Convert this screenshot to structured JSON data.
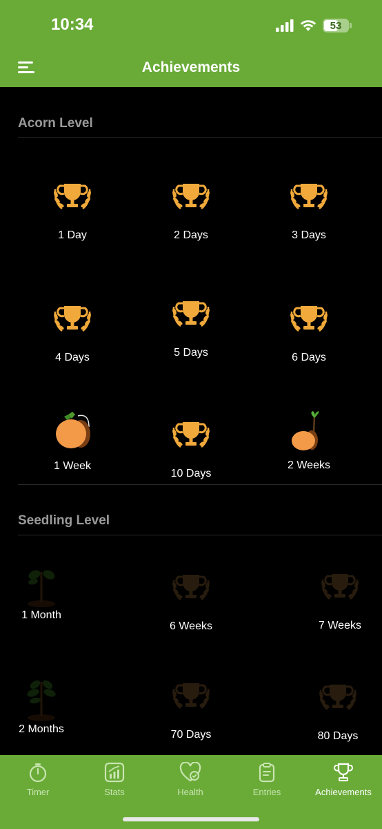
{
  "status_bar": {
    "time": "10:34",
    "battery": "53"
  },
  "header": {
    "title": "Achievements"
  },
  "sections": [
    {
      "title": "Acorn Level",
      "items": [
        {
          "label": "1 Day",
          "icon": "trophy-icon"
        },
        {
          "label": "2 Days",
          "icon": "trophy-icon"
        },
        {
          "label": "3 Days",
          "icon": "trophy-icon"
        },
        {
          "label": "4 Days",
          "icon": "trophy-icon"
        },
        {
          "label": "5 Days",
          "icon": "trophy-icon"
        },
        {
          "label": "6 Days",
          "icon": "trophy-icon"
        },
        {
          "label": "1 Week",
          "icon": "acorn-icon"
        },
        {
          "label": "10 Days",
          "icon": "trophy-icon"
        },
        {
          "label": "2 Weeks",
          "icon": "sprouting-acorn-icon"
        }
      ]
    },
    {
      "title": "Seedling Level",
      "items": [
        {
          "label": "1 Month",
          "icon": "seedling-icon"
        },
        {
          "label": "6 Weeks",
          "icon": "trophy-icon"
        },
        {
          "label": "7 Weeks",
          "icon": "trophy-icon"
        },
        {
          "label": "2 Months",
          "icon": "seedling-icon"
        },
        {
          "label": "70 Days",
          "icon": "trophy-icon"
        },
        {
          "label": "80 Days",
          "icon": "trophy-icon"
        }
      ]
    }
  ],
  "tabs": [
    {
      "label": "Timer",
      "icon": "stopwatch-icon"
    },
    {
      "label": "Stats",
      "icon": "chart-icon"
    },
    {
      "label": "Health",
      "icon": "heart-check-icon"
    },
    {
      "label": "Entries",
      "icon": "clipboard-icon"
    },
    {
      "label": "Achievements",
      "icon": "trophy-icon",
      "active": true
    }
  ],
  "colors": {
    "accent": "#6aab38",
    "trophy": "#f0a93a",
    "acorn": "#f29a48"
  }
}
